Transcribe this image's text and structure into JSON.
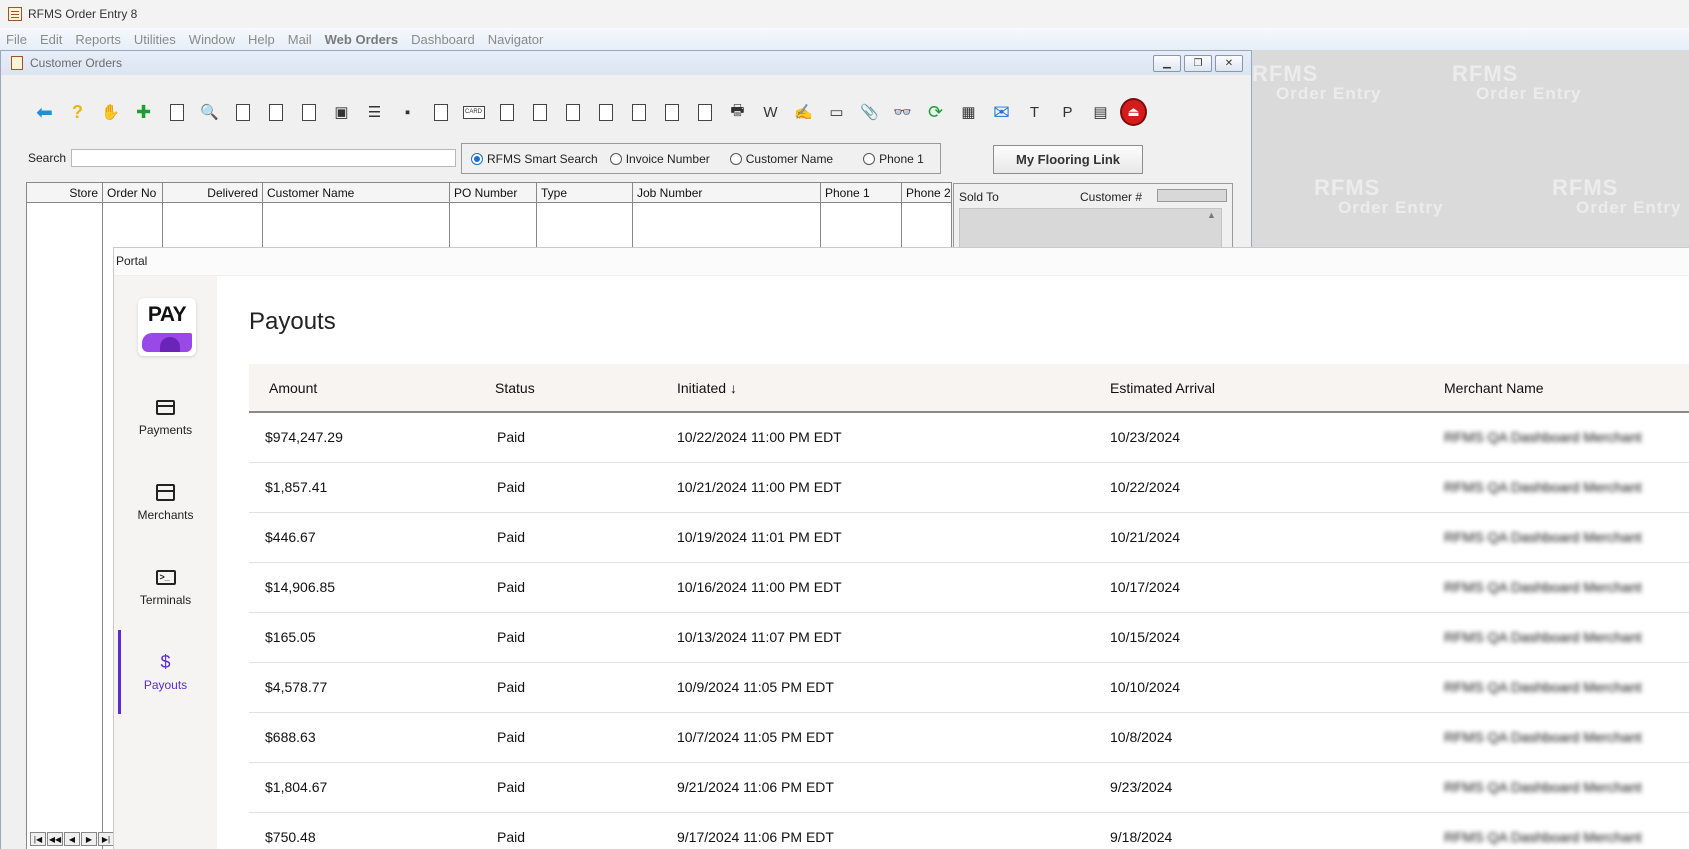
{
  "app": {
    "title": "RFMS Order Entry 8",
    "menu": [
      "File",
      "Edit",
      "Reports",
      "Utilities",
      "Window",
      "Help",
      "Mail",
      "Web Orders",
      "Dashboard",
      "Navigator"
    ]
  },
  "watermark": {
    "line1": "RFMS",
    "line2": "Order Entry"
  },
  "customer_orders": {
    "title": "Customer Orders",
    "search_label": "Search",
    "search_value": "",
    "search_options": [
      {
        "label": "RFMS Smart Search",
        "selected": true
      },
      {
        "label": "Invoice Number",
        "selected": false
      },
      {
        "label": "Customer Name",
        "selected": false
      },
      {
        "label": "Phone 1",
        "selected": false
      }
    ],
    "my_flooring_link": "My Flooring Link",
    "columns": [
      "Store",
      "Order No",
      "Delivered",
      "Customer Name",
      "PO Number",
      "Type",
      "Job Number",
      "Phone 1",
      "Phone 2"
    ],
    "sold_to_label": "Sold To",
    "customer_no_label": "Customer #"
  },
  "portal": {
    "window_title": "Portal",
    "logo_text": "PAY",
    "nav": [
      {
        "label": "Payments",
        "icon": "credit-card-icon",
        "active": false
      },
      {
        "label": "Merchants",
        "icon": "storefront-icon",
        "active": false
      },
      {
        "label": "Terminals",
        "icon": "terminal-icon",
        "active": false
      },
      {
        "label": "Payouts",
        "icon": "dollar-icon",
        "active": true
      }
    ],
    "page_title": "Payouts",
    "table": {
      "headers": [
        "Amount",
        "Status",
        "Initiated",
        "Estimated Arrival",
        "Merchant Name"
      ],
      "rows": [
        [
          "$974,247.29",
          "Paid",
          "10/22/2024 11:00 PM EDT",
          "10/23/2024",
          "RFMS QA Dashboard Merchant"
        ],
        [
          "$1,857.41",
          "Paid",
          "10/21/2024 11:00 PM EDT",
          "10/22/2024",
          "RFMS QA Dashboard Merchant"
        ],
        [
          "$446.67",
          "Paid",
          "10/19/2024 11:01 PM EDT",
          "10/21/2024",
          "RFMS QA Dashboard Merchant"
        ],
        [
          "$14,906.85",
          "Paid",
          "10/16/2024 11:00 PM EDT",
          "10/17/2024",
          "RFMS QA Dashboard Merchant"
        ],
        [
          "$165.05",
          "Paid",
          "10/13/2024 11:07 PM EDT",
          "10/15/2024",
          "RFMS QA Dashboard Merchant"
        ],
        [
          "$4,578.77",
          "Paid",
          "10/9/2024 11:05 PM EDT",
          "10/10/2024",
          "RFMS QA Dashboard Merchant"
        ],
        [
          "$688.63",
          "Paid",
          "10/7/2024 11:05 PM EDT",
          "10/8/2024",
          "RFMS QA Dashboard Merchant"
        ],
        [
          "$1,804.67",
          "Paid",
          "9/21/2024 11:06 PM EDT",
          "9/23/2024",
          "RFMS QA Dashboard Merchant"
        ],
        [
          "$750.48",
          "Paid",
          "9/17/2024 11:06 PM EDT",
          "9/18/2024",
          "RFMS QA Dashboard Merchant"
        ]
      ]
    }
  }
}
